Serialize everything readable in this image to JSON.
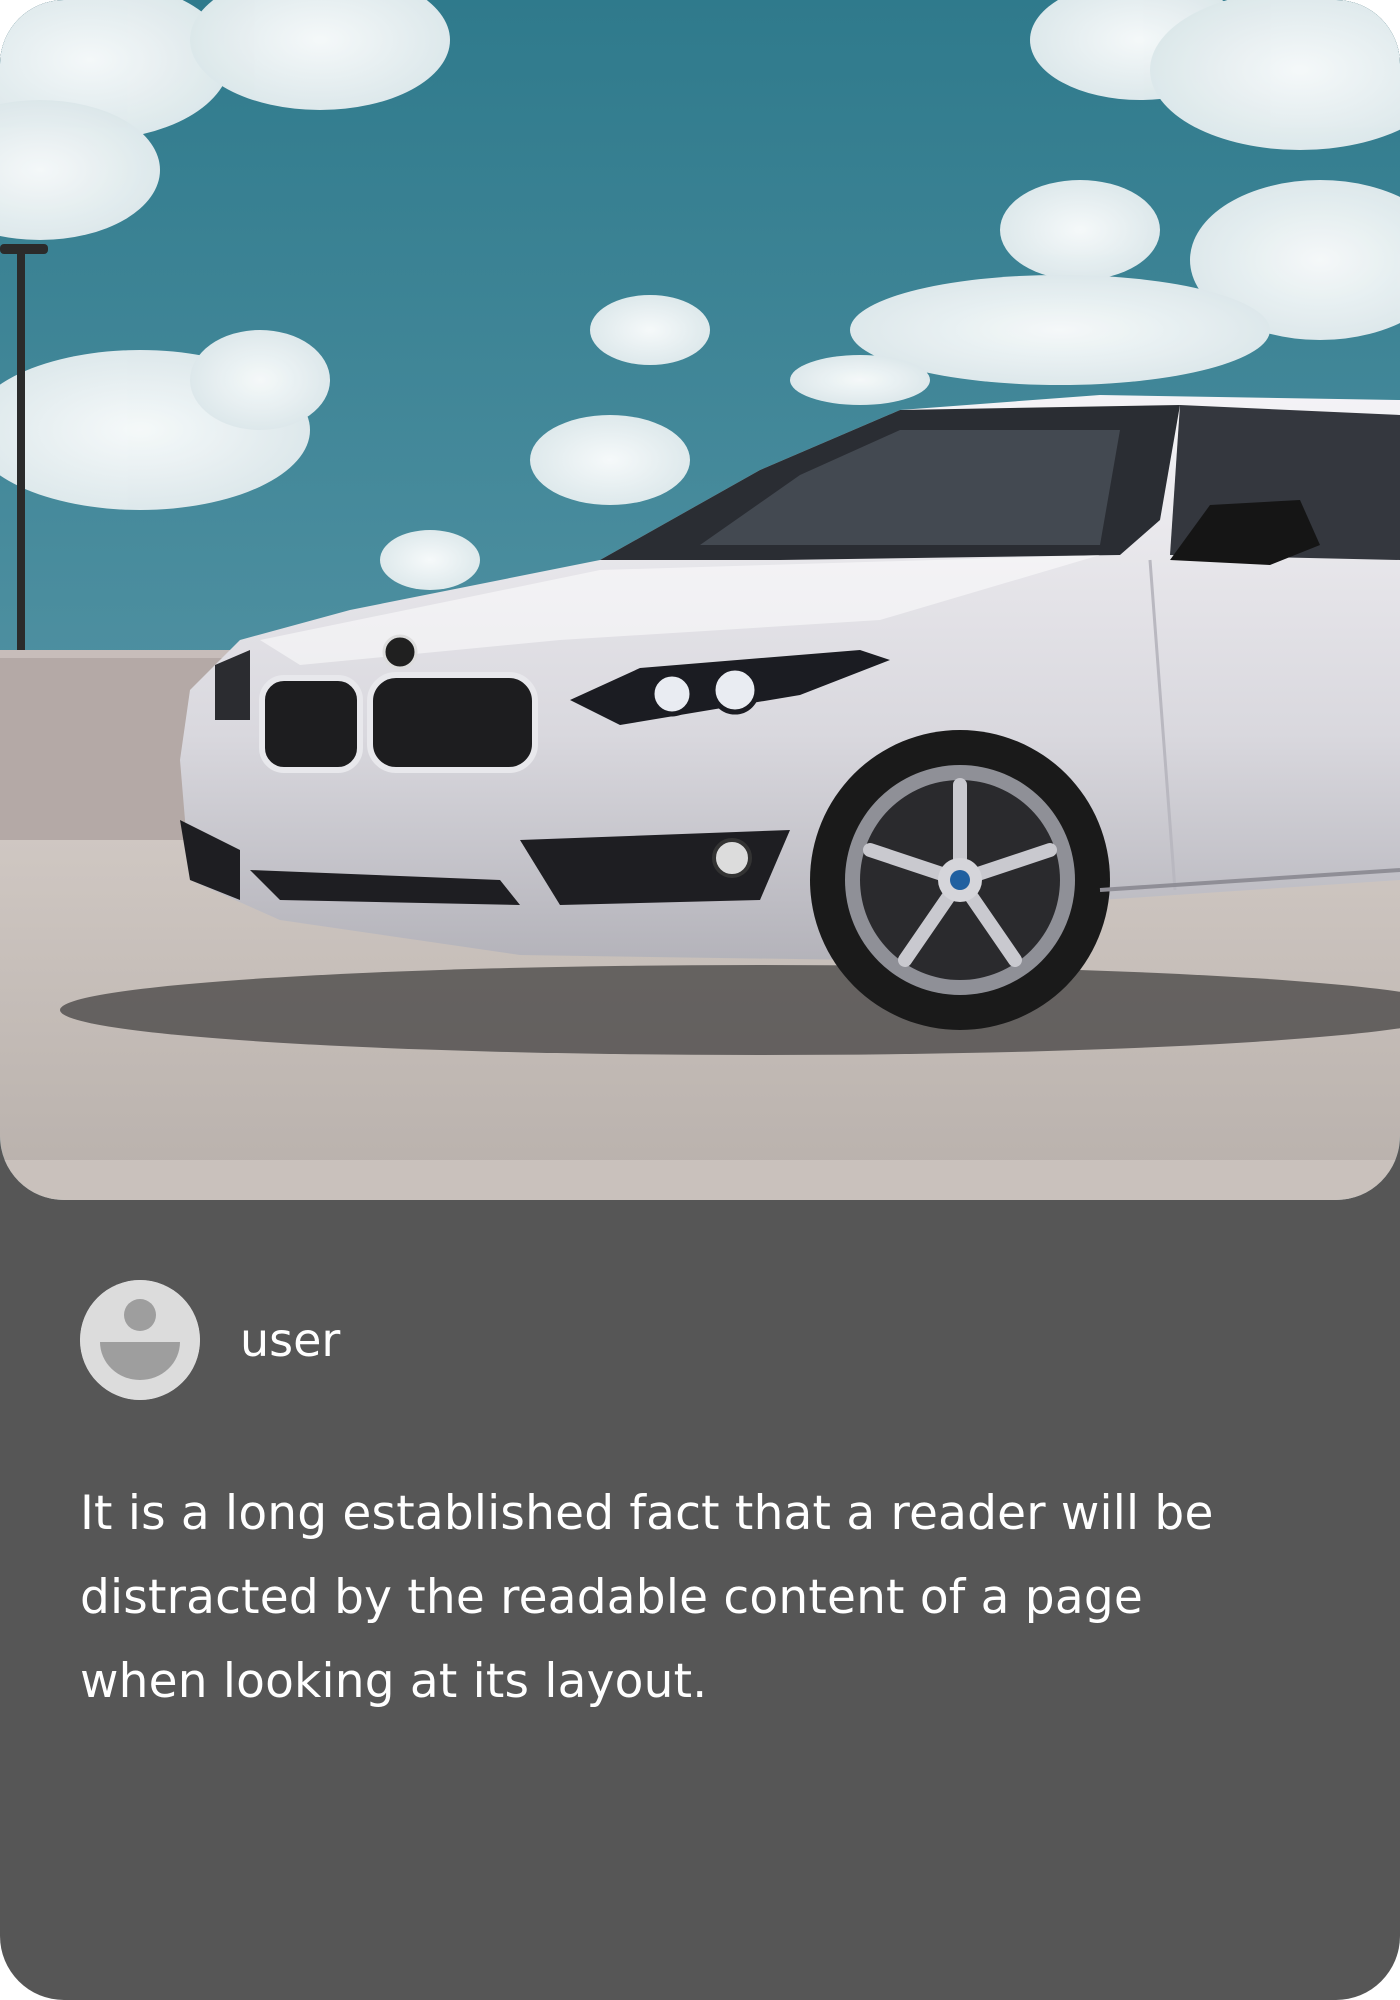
{
  "card": {
    "background_color": "#565656",
    "photo": {
      "subject": "white-bmw-coupe-on-rooftop-parking"
    },
    "author": {
      "avatar_icon": "user-avatar-icon",
      "name": "user"
    },
    "description": "It is a long established fact that a reader will be distracted by the readable content of a page when looking at its layout."
  }
}
